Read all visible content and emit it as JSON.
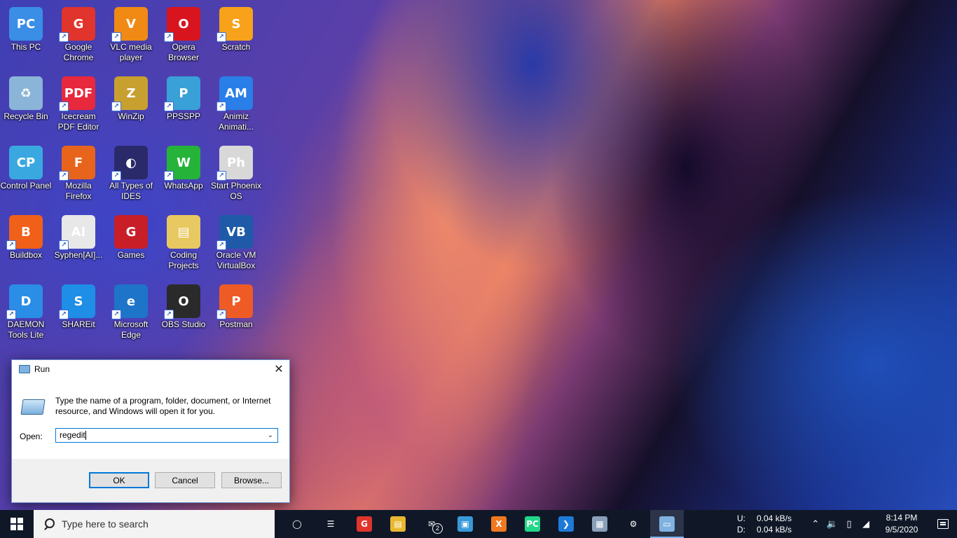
{
  "desktop": {
    "icons": [
      {
        "label": "This PC",
        "glyph": "PC",
        "color": "#3a8ee6",
        "shortcut": false
      },
      {
        "label": "Google Chrome",
        "glyph": "G",
        "color": "#e0342c",
        "shortcut": true
      },
      {
        "label": "VLC media player",
        "glyph": "V",
        "color": "#f08a14",
        "shortcut": true
      },
      {
        "label": "Opera Browser",
        "glyph": "O",
        "color": "#d8141e",
        "shortcut": true
      },
      {
        "label": "Scratch",
        "glyph": "S",
        "color": "#f7a21a",
        "shortcut": true
      },
      {
        "label": "Recycle Bin",
        "glyph": "♻",
        "color": "#8ab4d8",
        "shortcut": false
      },
      {
        "label": "Icecream PDF Editor",
        "glyph": "PDF",
        "color": "#e8283c",
        "shortcut": true
      },
      {
        "label": "WinZip",
        "glyph": "Z",
        "color": "#c8a030",
        "shortcut": true
      },
      {
        "label": "PPSSPP",
        "glyph": "P",
        "color": "#3aa0d8",
        "shortcut": true
      },
      {
        "label": "Animiz Animati...",
        "glyph": "AM",
        "color": "#2a7ee8",
        "shortcut": true
      },
      {
        "label": "Control Panel",
        "glyph": "CP",
        "color": "#3aa8e0",
        "shortcut": false
      },
      {
        "label": "Mozilla Firefox",
        "glyph": "F",
        "color": "#e8641c",
        "shortcut": true
      },
      {
        "label": "All Types of IDES",
        "glyph": "◐",
        "color": "#2a2a6a",
        "shortcut": true
      },
      {
        "label": "WhatsApp",
        "glyph": "W",
        "color": "#25b33a",
        "shortcut": true
      },
      {
        "label": "Start Phoenix OS",
        "glyph": "Ph",
        "color": "#d8d8d8",
        "shortcut": true
      },
      {
        "label": "Buildbox",
        "glyph": "B",
        "color": "#f06018",
        "shortcut": true
      },
      {
        "label": "Syphen[AI]...",
        "glyph": "AI",
        "color": "#e8e8e8",
        "shortcut": true
      },
      {
        "label": "Games",
        "glyph": "G",
        "color": "#c81e28",
        "shortcut": false
      },
      {
        "label": "Coding Projects",
        "glyph": "▤",
        "color": "#e8c860",
        "shortcut": false
      },
      {
        "label": "Oracle VM VirtualBox",
        "glyph": "VB",
        "color": "#1e5aa8",
        "shortcut": true
      },
      {
        "label": "DAEMON Tools Lite",
        "glyph": "D",
        "color": "#2a8ee6",
        "shortcut": true
      },
      {
        "label": "SHAREit",
        "glyph": "S",
        "color": "#1e8ee6",
        "shortcut": true
      },
      {
        "label": "Microsoft Edge",
        "glyph": "e",
        "color": "#1e74c8",
        "shortcut": true
      },
      {
        "label": "OBS Studio",
        "glyph": "O",
        "color": "#2a2a2a",
        "shortcut": true
      },
      {
        "label": "Postman",
        "glyph": "P",
        "color": "#ef5b25",
        "shortcut": true
      }
    ]
  },
  "run_dialog": {
    "title": "Run",
    "close_glyph": "✕",
    "description": "Type the name of a program, folder, document, or Internet resource, and Windows will open it for you.",
    "open_label": "Open:",
    "input_value": "regedit",
    "dropdown_glyph": "⌄",
    "ok_label": "OK",
    "cancel_label": "Cancel",
    "browse_label": "Browse..."
  },
  "taskbar": {
    "search_placeholder": "Type here to search",
    "apps": [
      {
        "name": "cortana-button",
        "glyph": "◯",
        "color": "transparent",
        "active": false
      },
      {
        "name": "task-view-button",
        "glyph": "☰",
        "color": "transparent",
        "active": false
      },
      {
        "name": "taskbar-chrome",
        "glyph": "G",
        "color": "#e0342c",
        "active": false
      },
      {
        "name": "taskbar-file-explorer",
        "glyph": "▤",
        "color": "#e8b830",
        "active": false
      },
      {
        "name": "taskbar-mail",
        "glyph": "✉",
        "color": "transparent",
        "active": false,
        "badge": "2"
      },
      {
        "name": "taskbar-app",
        "glyph": "▣",
        "color": "#3a9ad8",
        "active": false
      },
      {
        "name": "taskbar-xampp",
        "glyph": "X",
        "color": "#f07820",
        "active": false
      },
      {
        "name": "taskbar-pycharm",
        "glyph": "PC",
        "color": "#21d789",
        "active": false
      },
      {
        "name": "taskbar-vscode",
        "glyph": "❯",
        "color": "#1e7ad8",
        "active": false
      },
      {
        "name": "taskbar-app-2",
        "glyph": "▦",
        "color": "#8aa0b8",
        "active": false
      },
      {
        "name": "taskbar-settings",
        "glyph": "⚙",
        "color": "transparent",
        "active": false
      },
      {
        "name": "taskbar-run",
        "glyph": "▭",
        "color": "#7fb2e0",
        "active": true
      }
    ],
    "net_upload_label": "U:",
    "net_upload_value": "0.04 kB/s",
    "net_download_label": "D:",
    "net_download_value": "0.04 kB/s",
    "tray_chevron": "⌃",
    "tray_volume": "🔉",
    "tray_power": "▯",
    "tray_wifi": "◢",
    "clock_time": "8:14 PM",
    "clock_date": "9/5/2020"
  }
}
